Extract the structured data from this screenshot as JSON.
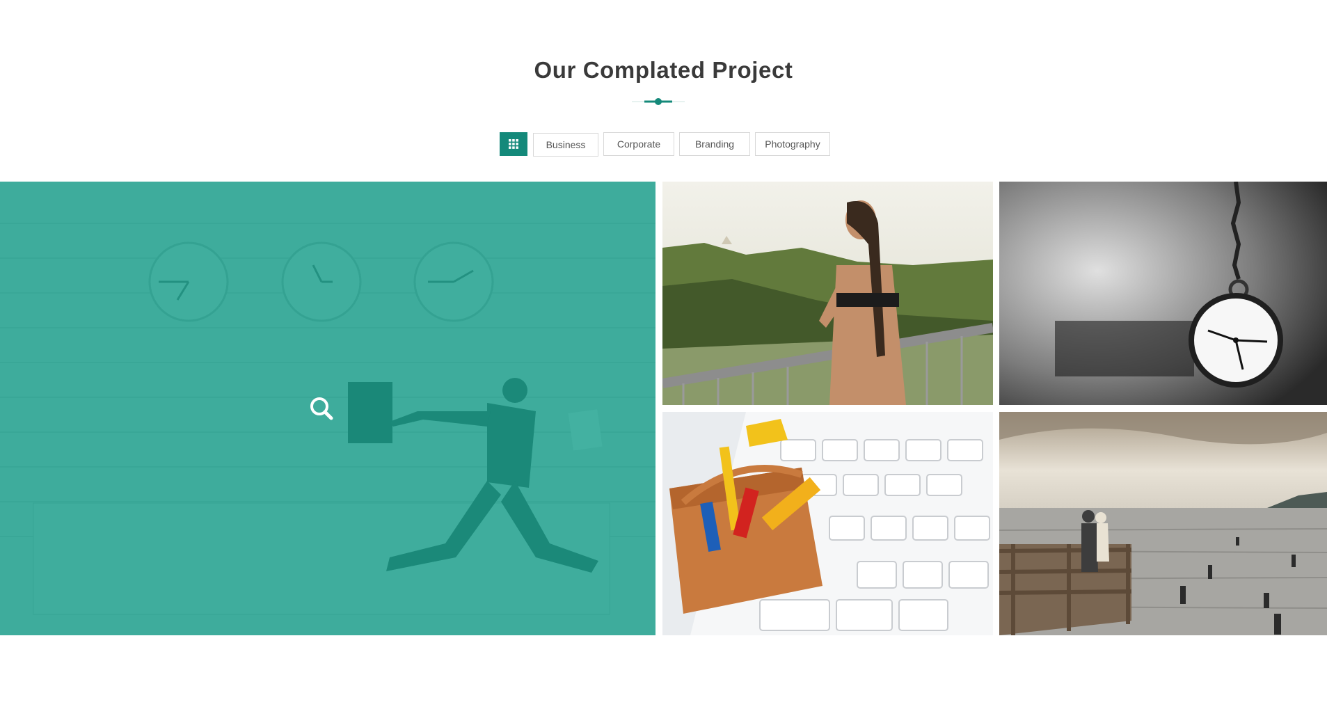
{
  "section": {
    "title": "Our Complated Project"
  },
  "filters": {
    "all_icon": "grid-icon",
    "items": [
      {
        "label": "Business"
      },
      {
        "label": "Corporate"
      },
      {
        "label": "Branding"
      },
      {
        "label": "Photography"
      }
    ]
  },
  "colors": {
    "accent": "#14897a",
    "overlay": "#16a08c",
    "title": "#3a3a3a"
  },
  "portfolio": {
    "items": [
      {
        "name": "businessman-running",
        "icon": "search-icon",
        "hover": true
      },
      {
        "name": "woman-on-balcony",
        "hover": false
      },
      {
        "name": "pocket-watch",
        "hover": false
      },
      {
        "name": "toolbox-keyboard",
        "hover": false
      },
      {
        "name": "couple-on-pier",
        "hover": false
      }
    ]
  }
}
